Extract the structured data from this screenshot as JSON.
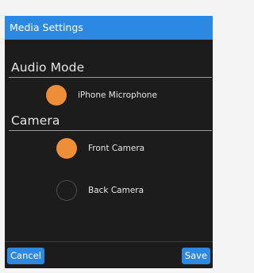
{
  "dialog": {
    "title": "Media Settings"
  },
  "audio": {
    "section_title": "Audio Mode",
    "options": [
      {
        "label": "iPhone Microphone",
        "selected": true
      }
    ]
  },
  "camera": {
    "section_title": "Camera",
    "options": [
      {
        "label": "Front Camera",
        "selected": true
      },
      {
        "label": "Back Camera",
        "selected": false
      }
    ]
  },
  "footer": {
    "cancel_label": "Cancel",
    "save_label": "Save"
  },
  "colors": {
    "accent": "#2c88e0",
    "radio_selected": "#ee8e36",
    "background": "#1c1c1c"
  }
}
